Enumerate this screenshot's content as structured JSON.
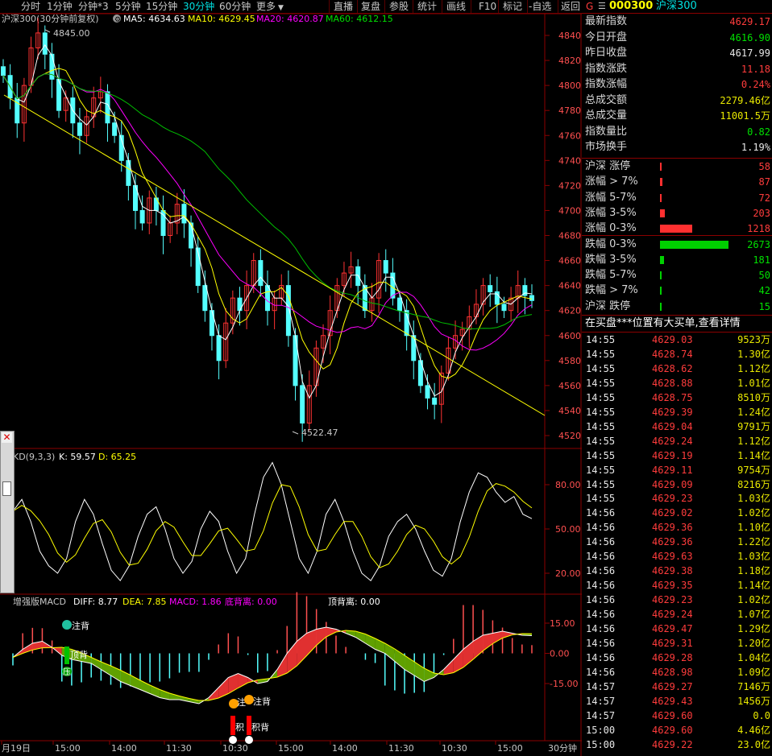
{
  "toolbar": {
    "items": [
      "分时",
      "1分钟",
      "分钟*3",
      "5分钟",
      "15分钟",
      "30分钟",
      "60分钟",
      "更多"
    ],
    "active_index": 5,
    "right_items": [
      "直播",
      "复盘",
      "参股",
      "统计",
      "画线",
      "F10",
      "标记",
      "-自选",
      "返回"
    ]
  },
  "main_chart": {
    "title": "沪深300(30分钟前复权)",
    "ma5": "MA5: 4634.63",
    "ma10": "MA10: 4629.45",
    "ma20": "MA20: 4620.87",
    "ma60": "MA60: 4612.15",
    "y_labels": [
      "4840",
      "4820",
      "4800",
      "4780",
      "4760",
      "4740",
      "4720",
      "4700",
      "4680",
      "4660",
      "4640",
      "4620",
      "4600",
      "4580",
      "4560",
      "4540",
      "4520"
    ],
    "high_label": "4845.00",
    "low_label": "4522.47",
    "colors": {
      "up": "#ff3232",
      "down": "#54ffff",
      "ma5": "#ffffff",
      "ma10": "#ffff00",
      "ma20": "#ff00ff",
      "ma60": "#00c000",
      "trend": "#ffff00",
      "grid": "#8b0000"
    }
  },
  "kd_panel": {
    "title": "KD(9,3,3)",
    "k": "K: 59.57",
    "d": "D: 65.25",
    "y_labels": [
      "80.00",
      "50.00",
      "20.00"
    ]
  },
  "macd_panel": {
    "title": "增强版MACD",
    "diff": "DIFF: 8.77",
    "dea": "DEA: 7.85",
    "macd": "MACD: 1.86",
    "bottom_div": "底背离: 0.00",
    "top_div": "顶背离: 0.00",
    "y_labels": [
      "15.00",
      "0.00",
      "-15.00"
    ],
    "markers": [
      "注背",
      "顶背",
      "压",
      "注",
      "注背",
      "积",
      "积背"
    ]
  },
  "x_axis": {
    "labels": [
      "月19日",
      "15:00",
      "14:00",
      "11:30",
      "10:30",
      "15:00",
      "14:00",
      "11:30",
      "10:30",
      "15:00"
    ],
    "period": "30分钟"
  },
  "right_panel": {
    "header_letter": "G",
    "header_menu": "☰",
    "code": "000300",
    "name": "沪深300",
    "quotes": [
      {
        "label": "最新指数",
        "value": "4629.17",
        "color": "red"
      },
      {
        "label": "今日开盘",
        "value": "4616.90",
        "color": "green"
      },
      {
        "label": "昨日收盘",
        "value": "4617.99",
        "color": "white"
      },
      {
        "label": "指数涨跌",
        "value": "11.18",
        "color": "red"
      },
      {
        "label": "指数涨幅",
        "value": "0.24%",
        "color": "red"
      },
      {
        "label": "总成交额",
        "value": "2279.46亿",
        "color": "yellow"
      },
      {
        "label": "总成交量",
        "value": "11001.5万",
        "color": "yellow"
      },
      {
        "label": "指数量比",
        "value": "0.82",
        "color": "green"
      },
      {
        "label": "市场换手",
        "value": "1.19%",
        "color": "white"
      }
    ],
    "distribution": [
      {
        "label": "沪深 涨停",
        "value": "58",
        "bar": 0.01,
        "color": "red"
      },
      {
        "label": "涨幅 > 7%",
        "value": "87",
        "bar": 0.015,
        "color": "red"
      },
      {
        "label": "涨幅 5-7%",
        "value": "72",
        "bar": 0.012,
        "color": "red"
      },
      {
        "label": "涨幅 3-5%",
        "value": "203",
        "bar": 0.035,
        "color": "red"
      },
      {
        "label": "涨幅 0-3%",
        "value": "1218",
        "bar": 0.22,
        "color": "red"
      },
      {
        "label": "跌幅 0-3%",
        "value": "2673",
        "bar": 0.47,
        "color": "green"
      },
      {
        "label": "跌幅 3-5%",
        "value": "181",
        "bar": 0.03,
        "color": "green"
      },
      {
        "label": "跌幅 5-7%",
        "value": "50",
        "bar": 0.008,
        "color": "green"
      },
      {
        "label": "跌幅 > 7%",
        "value": "42",
        "bar": 0.007,
        "color": "green"
      },
      {
        "label": "沪深 跌停",
        "value": "15",
        "bar": 0.003,
        "color": "green"
      }
    ],
    "ticker_banner": "在买盘***位置有大买单,查看详情",
    "ticks": [
      {
        "time": "14:55",
        "price": "4629.03",
        "vol": "9523万"
      },
      {
        "time": "14:55",
        "price": "4628.74",
        "vol": "1.30亿"
      },
      {
        "time": "14:55",
        "price": "4628.62",
        "vol": "1.12亿"
      },
      {
        "time": "14:55",
        "price": "4628.88",
        "vol": "1.01亿"
      },
      {
        "time": "14:55",
        "price": "4628.75",
        "vol": "8510万"
      },
      {
        "time": "14:55",
        "price": "4629.39",
        "vol": "1.24亿"
      },
      {
        "time": "14:55",
        "price": "4629.04",
        "vol": "9791万"
      },
      {
        "time": "14:55",
        "price": "4629.24",
        "vol": "1.12亿"
      },
      {
        "time": "14:55",
        "price": "4629.19",
        "vol": "1.14亿"
      },
      {
        "time": "14:55",
        "price": "4629.11",
        "vol": "9754万"
      },
      {
        "time": "14:55",
        "price": "4629.09",
        "vol": "8216万"
      },
      {
        "time": "14:55",
        "price": "4629.23",
        "vol": "1.03亿"
      },
      {
        "time": "14:56",
        "price": "4629.02",
        "vol": "1.02亿"
      },
      {
        "time": "14:56",
        "price": "4629.36",
        "vol": "1.10亿"
      },
      {
        "time": "14:56",
        "price": "4629.36",
        "vol": "1.22亿"
      },
      {
        "time": "14:56",
        "price": "4629.63",
        "vol": "1.03亿"
      },
      {
        "time": "14:56",
        "price": "4629.38",
        "vol": "1.18亿"
      },
      {
        "time": "14:56",
        "price": "4629.35",
        "vol": "1.14亿"
      },
      {
        "time": "14:56",
        "price": "4629.23",
        "vol": "1.02亿"
      },
      {
        "time": "14:56",
        "price": "4629.24",
        "vol": "1.07亿"
      },
      {
        "time": "14:56",
        "price": "4629.47",
        "vol": "1.29亿"
      },
      {
        "time": "14:56",
        "price": "4629.31",
        "vol": "1.20亿"
      },
      {
        "time": "14:56",
        "price": "4629.28",
        "vol": "1.04亿"
      },
      {
        "time": "14:56",
        "price": "4628.98",
        "vol": "1.09亿"
      },
      {
        "time": "14:57",
        "price": "4629.27",
        "vol": "7146万"
      },
      {
        "time": "14:57",
        "price": "4629.43",
        "vol": "1456万"
      },
      {
        "time": "14:57",
        "price": "4629.60",
        "vol": "0.0"
      },
      {
        "time": "15:00",
        "price": "4629.60",
        "vol": "4.46亿"
      },
      {
        "time": "15:00",
        "price": "4629.22",
        "vol": "23.0亿"
      }
    ]
  }
}
